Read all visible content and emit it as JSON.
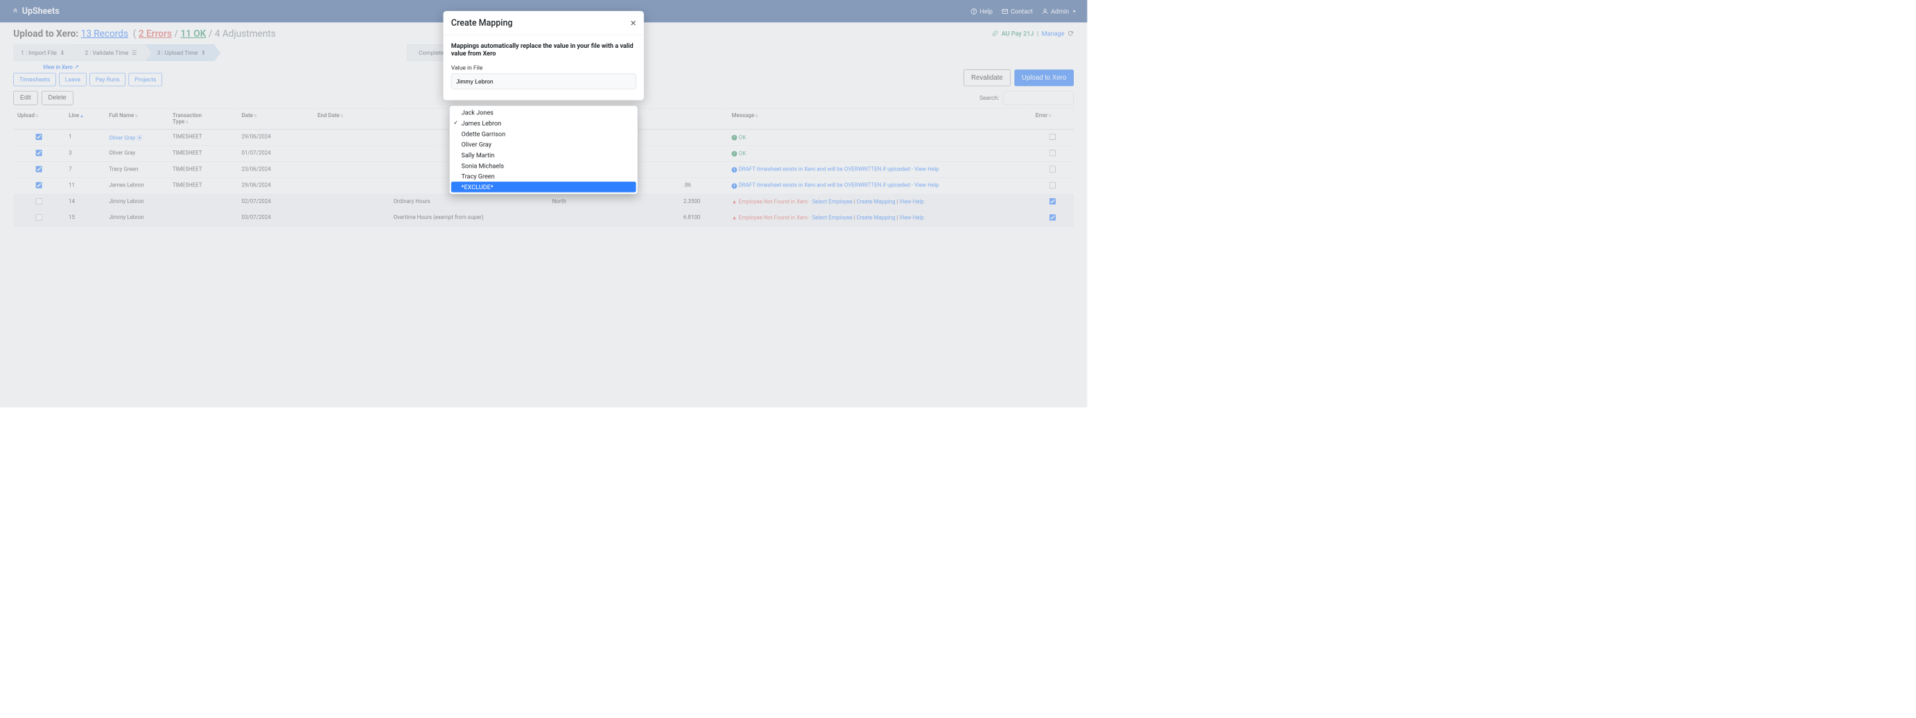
{
  "brand": "UpSheets",
  "nav": {
    "help": "Help",
    "contact": "Contact",
    "admin": "Admin"
  },
  "title": {
    "prefix": "Upload to Xero:",
    "records": "13 Records",
    "errors": "2 Errors",
    "ok": "11 OK",
    "adjustments": "4 Adjustments"
  },
  "org": {
    "name": "AU Pay 21J",
    "manage": "Manage"
  },
  "steps": {
    "s1": "1 : Import File",
    "s2": "2 : Validate Time",
    "s3": "3 : Upload Time",
    "s_complete": "Complete"
  },
  "view_in_xero": "View in Xero",
  "pills": {
    "timesheets": "Timesheets",
    "leave": "Leave",
    "payruns": "Pay Runs",
    "projects": "Projects"
  },
  "side_btns": {
    "revalidate": "Revalidate",
    "upload": "Upload to Xero"
  },
  "toolbar": {
    "edit": "Edit",
    "delete": "Delete",
    "search_label": "Search:"
  },
  "cols": {
    "upload": "Upload",
    "line": "Line",
    "full_name": "Full Name",
    "txn_type": "Transaction\nType",
    "date": "Date",
    "end_date": "End Date",
    "message": "Message",
    "error": "Error"
  },
  "ok_text": "OK",
  "msgs": {
    "draft": "DRAFT timesheet exists in Xero and will be OVERWRITTEN if uploaded -",
    "view_help": "View Help",
    "emp_nf": "Employee Not Found in Xero -",
    "select_emp": "Select Employee",
    "create_map": "Create Mapping"
  },
  "rows": [
    {
      "upload": true,
      "line": "1",
      "name": "Oliver Gray",
      "verified": true,
      "txn": "TIMESHEET",
      "date": "29/06/2024",
      "cat": "",
      "loc": "",
      "val": "",
      "msg_type": "ok"
    },
    {
      "upload": true,
      "line": "3",
      "name": "Oliver Gray",
      "verified": false,
      "txn": "TIMESHEET",
      "date": "01/07/2024",
      "cat": "",
      "loc": "",
      "val": "",
      "msg_type": "ok"
    },
    {
      "upload": true,
      "line": "7",
      "name": "Tracy Green",
      "verified": false,
      "txn": "TIMESHEET",
      "date": "23/06/2024",
      "cat": "",
      "loc": "",
      "val": "",
      "msg_type": "draft"
    },
    {
      "upload": true,
      "line": "11",
      "name": "James Lebron",
      "verified": false,
      "txn": "TIMESHEET",
      "date": "29/06/2024",
      "cat": "",
      "loc": "",
      "val": ".86",
      "msg_type": "draft"
    },
    {
      "upload": false,
      "line": "14",
      "name": "Jimmy Lebron",
      "verified": false,
      "txn": "",
      "date": "02/07/2024",
      "cat": "Ordinary Hours",
      "loc": "North",
      "val": "2.3500",
      "msg_type": "err",
      "err_chk": true
    },
    {
      "upload": false,
      "line": "15",
      "name": "Jimmy Lebron",
      "verified": false,
      "txn": "",
      "date": "03/07/2024",
      "cat": "Overtime Hours (exempt from super)",
      "loc": "",
      "val": "6.8100",
      "msg_type": "err",
      "err_chk": true
    }
  ],
  "modal": {
    "title": "Create Mapping",
    "desc": "Mappings automatically replace the value in your file with a valid value from Xero",
    "label1": "Value in File",
    "value1": "Jimmy Lebron"
  },
  "dropdown": {
    "items": [
      {
        "label": "Jack Jones"
      },
      {
        "label": "James Lebron",
        "checked": true
      },
      {
        "label": "Odette Garrison"
      },
      {
        "label": "Oliver Gray"
      },
      {
        "label": "Sally Martin"
      },
      {
        "label": "Sonia Michaels"
      },
      {
        "label": "Tracy Green"
      },
      {
        "label": "*EXCLUDE*",
        "highlighted": true
      }
    ]
  }
}
